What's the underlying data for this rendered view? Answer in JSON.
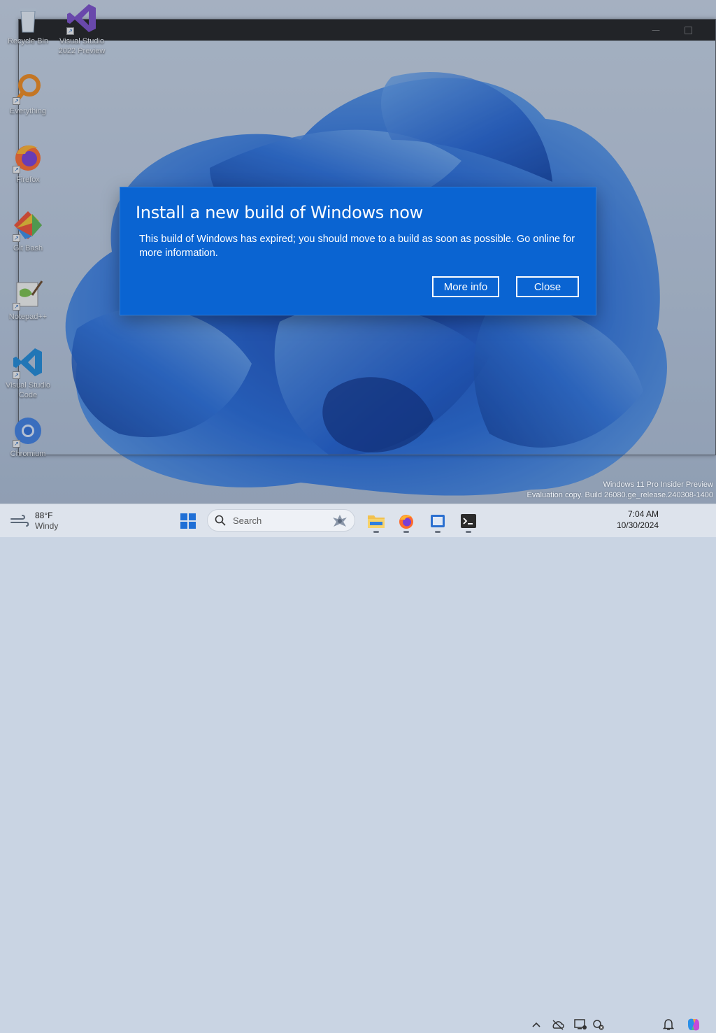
{
  "desktop": {
    "icons": [
      {
        "label": "Recycle Bin",
        "icon": "recycle-bin-icon"
      },
      {
        "label": "Visual Studio 2022 Preview",
        "icon": "visual-studio-icon"
      },
      {
        "label": "Everything",
        "icon": "everything-icon"
      },
      {
        "label": "Firefox",
        "icon": "firefox-icon"
      },
      {
        "label": "Git Bash",
        "icon": "git-bash-icon"
      },
      {
        "label": "Notepad++",
        "icon": "notepadpp-icon"
      },
      {
        "label": "Visual Studio Code",
        "icon": "vscode-icon"
      },
      {
        "label": "Chromium",
        "icon": "chromium-icon"
      }
    ]
  },
  "window": {
    "minimize_glyph": "—",
    "maximize_icon": "maximize-icon"
  },
  "dialog": {
    "title": "Install a new build of Windows now",
    "body": "This build of Windows has expired; you should move to a build as soon as possible. Go online for more information.",
    "more_info_label": "More info",
    "close_label": "Close",
    "background": "#0a64d2"
  },
  "watermark": {
    "line1": "Windows 11 Pro Insider Preview",
    "line2": "Evaluation copy. Build 26080.ge_release.240308-1400"
  },
  "taskbar": {
    "weather_temp": "88°F",
    "weather_condition": "Windy",
    "search_placeholder": "Search",
    "pinned": [
      "start-icon",
      "file-explorer-icon",
      "firefox-icon",
      "task-view-icon",
      "terminal-icon"
    ],
    "tray": [
      "chevron-up-icon",
      "network-offline-icon",
      "display-icon",
      "vpn-icon",
      "bell-icon",
      "copilot-icon"
    ],
    "time": "7:04 AM",
    "date": "10/30/2024"
  },
  "colors": {
    "accent": "#0a64d2",
    "taskbar": "#dde3ec",
    "titlebar": "#202020"
  }
}
